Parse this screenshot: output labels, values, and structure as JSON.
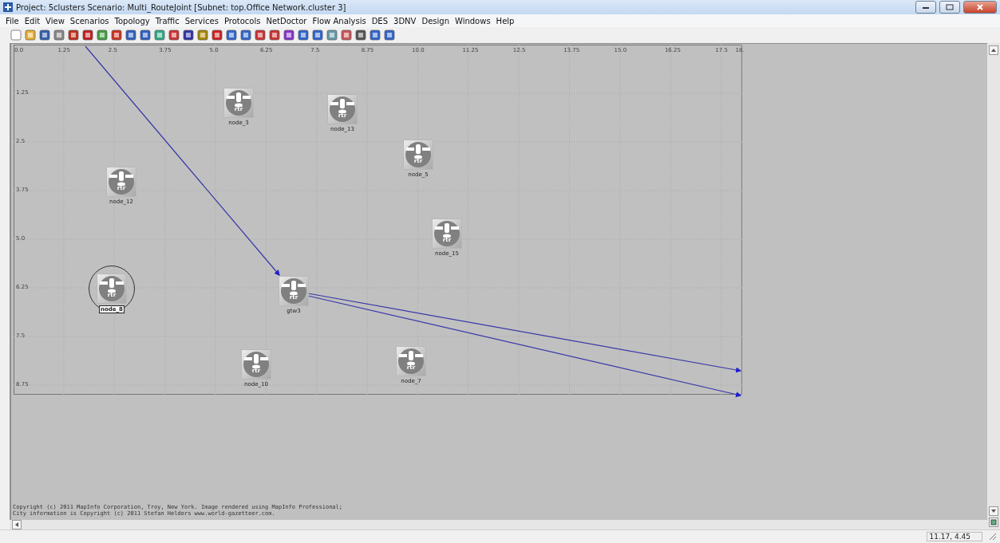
{
  "window": {
    "title": "Project: 5clusters Scenario: Multi_RouteJoint  [Subnet: top.Office Network.cluster 3]"
  },
  "menu": [
    "File",
    "Edit",
    "View",
    "Scenarios",
    "Topology",
    "Traffic",
    "Services",
    "Protocols",
    "NetDoctor",
    "Flow Analysis",
    "DES",
    "3DNV",
    "Design",
    "Windows",
    "Help"
  ],
  "canvas": {
    "x_ticks": [
      "0.0",
      "1.25",
      "2.5",
      "3.75",
      "5.0",
      "6.25",
      "7.5",
      "8.75",
      "10.0",
      "11.25",
      "12.5",
      "13.75",
      "15.0",
      "16.25",
      "17.5",
      "18."
    ],
    "y_ticks": [
      "1.25",
      "2.5",
      "3.75",
      "5.0",
      "6.25",
      "7.5",
      "8.75"
    ],
    "nodes": [
      {
        "label": "node_3",
        "icon_text": "rtr",
        "selected": false
      },
      {
        "label": "node_13",
        "icon_text": "rtr",
        "selected": false
      },
      {
        "label": "node_5",
        "icon_text": "rtr",
        "selected": false
      },
      {
        "label": "node_12",
        "icon_text": "rtr",
        "selected": false
      },
      {
        "label": "node_15",
        "icon_text": "rtr",
        "selected": false
      },
      {
        "label": "node_8",
        "icon_text": "rtr",
        "selected": true
      },
      {
        "label": "gtw3",
        "icon_text": "rtr",
        "selected": false
      },
      {
        "label": "node_10",
        "icon_text": "rtr",
        "selected": false
      },
      {
        "label": "node_7",
        "icon_text": "rtr",
        "selected": false
      }
    ],
    "copyright": [
      "Copyright (c) 2011 MapInfo Corporation, Troy, New York. Image rendered using MapInfo Professional;",
      "City information is Copyright (c) 2011 Stefan Helders www.world-gazetteer.com."
    ]
  },
  "status_bar": {
    "coordinates": "11.17, 4.45"
  }
}
